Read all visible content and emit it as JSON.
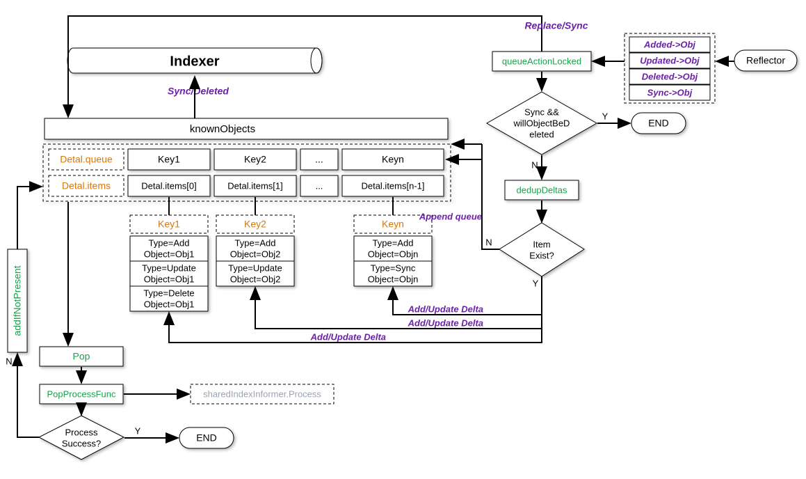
{
  "top": {
    "indexer": "Indexer",
    "known_objects": "knownObjects",
    "sync_deleted": "Sync/Deleted",
    "replace_sync": "Replace/Sync"
  },
  "queue": {
    "label": "Detal.queue",
    "cells": [
      "Key1",
      "Key2",
      "...",
      "Keyn"
    ]
  },
  "items": {
    "label": "Detal.items",
    "cells": [
      "Detal.items[0]",
      "Detal.items[1]",
      "...",
      "Detal.items[n-1]"
    ]
  },
  "keyboxes": [
    {
      "title": "Key1",
      "rows": [
        "Type=Add\nObject=Obj1",
        "Type=Update\nObject=Obj1",
        "Type=Delete\nObject=Obj1"
      ]
    },
    {
      "title": "Key2",
      "rows": [
        "Type=Add\nObject=Obj2",
        "Type=Update\nObject=Obj2"
      ]
    },
    {
      "title": "Keyn",
      "rows": [
        "Type=Add\nObject=Objn",
        "Type=Sync\nObject=Objn"
      ]
    }
  ],
  "left": {
    "add_if_not_present": "addIfNotPresent",
    "pop": "Pop",
    "pop_process": "PopProcessFunc",
    "shared_informer": "sharedIndexInformer.Process",
    "process_success": "Process\nSuccess?",
    "end": "END",
    "y": "Y",
    "n": "N"
  },
  "right": {
    "queue_action_locked": "queueActionLocked",
    "events": [
      "Added->Obj",
      "Updated->Obj",
      "Deleted->Obj",
      "Sync->Obj"
    ],
    "reflector": "Reflector",
    "sync_will": "Sync &&\nwillObjectBeD\neleted",
    "end": "END",
    "dedup": "dedupDeltas",
    "item_exist": "Item\nExist?",
    "append_queue": "Append queue",
    "add_update_delta": "Add/Update Delta",
    "y": "Y",
    "n": "N"
  }
}
